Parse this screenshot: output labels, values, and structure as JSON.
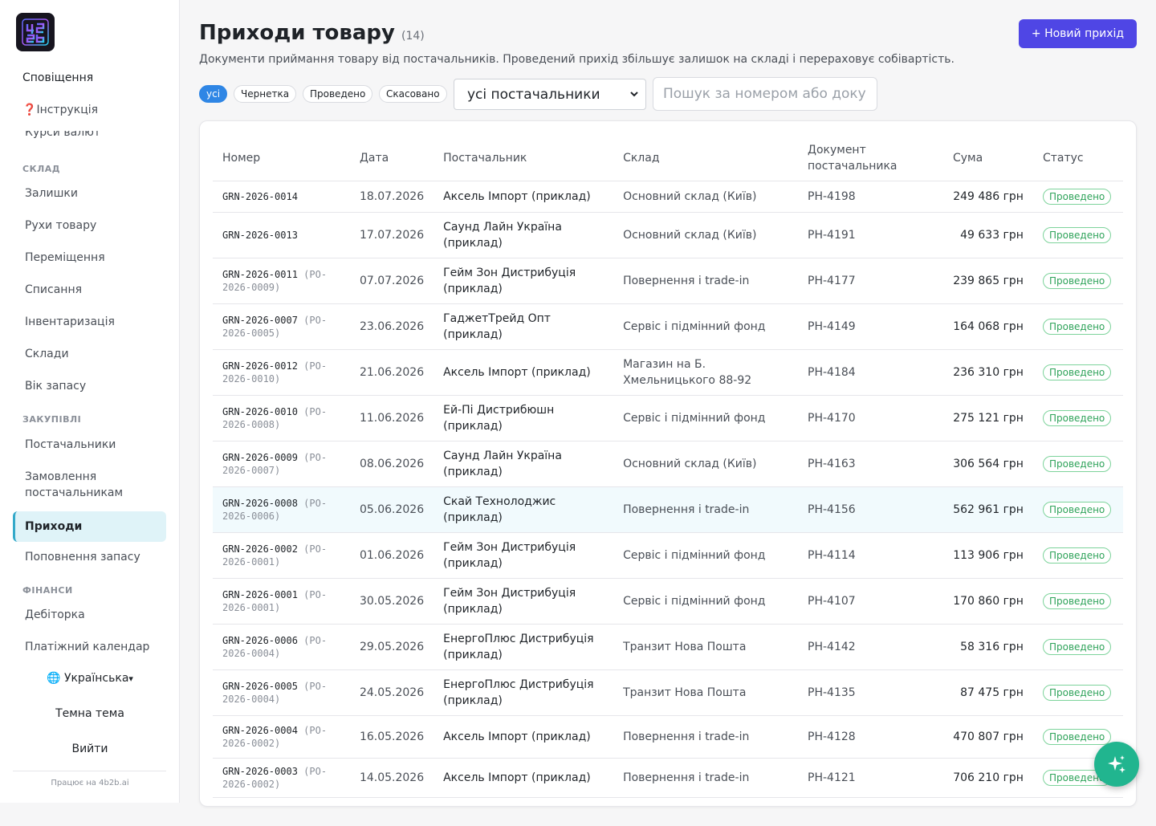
{
  "sidebar": {
    "notifications": "Сповіщення",
    "instructions_icon": "question-icon",
    "instructions": "Інструкція",
    "currency_cut": "Курси валют",
    "sections": {
      "warehouse": "СКЛАД",
      "purchases": "ЗАКУПІВЛІ",
      "finance": "ФІНАНСИ"
    },
    "warehouse_items": [
      "Залишки",
      "Рухи товару",
      "Переміщення",
      "Списання",
      "Інвентаризація",
      "Склади",
      "Вік запасу"
    ],
    "purchase_items": [
      "Постачальники",
      "Замовлення постачальникам",
      "Приходи",
      "Поповнення запасу"
    ],
    "finance_items": [
      "Дебіторка",
      "Платіжний календар"
    ],
    "language_icon": "globe-icon",
    "language": "Українська",
    "theme": "Темна тема",
    "logout": "Вийти",
    "powered": "Працює на 4b2b.ai"
  },
  "header": {
    "title": "Приходи товару",
    "count": "(14)",
    "subtitle": "Документи приймання товару від постачальників. Проведений прихід збільшує залишок на складі і перераховує собівартість.",
    "new_button": "+ Новий прихід"
  },
  "filters": {
    "chips": [
      "усі",
      "Чернетка",
      "Проведено",
      "Скасовано"
    ],
    "active_chip": "усі",
    "supplier_select": "усі постачальники",
    "search_placeholder": "Пошук за номером або документом",
    "search_value": ""
  },
  "table": {
    "headers": [
      "Номер",
      "Дата",
      "Постачальник",
      "Склад",
      "Документ постачальника",
      "Сума",
      "Статус"
    ],
    "rows": [
      {
        "num": "GRN-2026-0014",
        "po": "",
        "date": "18.07.2026",
        "supplier": "Аксель Імпорт (приклад)",
        "warehouse": "Основний склад (Київ)",
        "doc": "РН-4198",
        "sum": "249 486 грн",
        "status": "Проведено"
      },
      {
        "num": "GRN-2026-0013",
        "po": "",
        "date": "17.07.2026",
        "supplier": "Саунд Лайн Україна (приклад)",
        "warehouse": "Основний склад (Київ)",
        "doc": "РН-4191",
        "sum": "49 633 грн",
        "status": "Проведено"
      },
      {
        "num": "GRN-2026-0011",
        "po": "(PO-2026-0009)",
        "date": "07.07.2026",
        "supplier": "Гейм Зон Дистрибуція (приклад)",
        "warehouse": "Повернення і trade-in",
        "doc": "РН-4177",
        "sum": "239 865 грн",
        "status": "Проведено"
      },
      {
        "num": "GRN-2026-0007",
        "po": "(PO-2026-0005)",
        "date": "23.06.2026",
        "supplier": "ГаджетТрейд Опт (приклад)",
        "warehouse": "Сервіс і підмінний фонд",
        "doc": "РН-4149",
        "sum": "164 068 грн",
        "status": "Проведено"
      },
      {
        "num": "GRN-2026-0012",
        "po": "(PO-2026-0010)",
        "date": "21.06.2026",
        "supplier": "Аксель Імпорт (приклад)",
        "warehouse": "Магазин на Б. Хмельницького 88-92",
        "doc": "РН-4184",
        "sum": "236 310 грн",
        "status": "Проведено"
      },
      {
        "num": "GRN-2026-0010",
        "po": "(PO-2026-0008)",
        "date": "11.06.2026",
        "supplier": "Ей-Пі Дистрибюшн (приклад)",
        "warehouse": "Сервіс і підмінний фонд",
        "doc": "РН-4170",
        "sum": "275 121 грн",
        "status": "Проведено"
      },
      {
        "num": "GRN-2026-0009",
        "po": "(PO-2026-0007)",
        "date": "08.06.2026",
        "supplier": "Саунд Лайн Україна (приклад)",
        "warehouse": "Основний склад (Київ)",
        "doc": "РН-4163",
        "sum": "306 564 грн",
        "status": "Проведено"
      },
      {
        "num": "GRN-2026-0008",
        "po": "(PO-2026-0006)",
        "date": "05.06.2026",
        "supplier": "Скай Технолоджис (приклад)",
        "warehouse": "Повернення і trade-in",
        "doc": "РН-4156",
        "sum": "562 961 грн",
        "status": "Проведено"
      },
      {
        "num": "GRN-2026-0002",
        "po": "(PO-2026-0001)",
        "date": "01.06.2026",
        "supplier": "Гейм Зон Дистрибуція (приклад)",
        "warehouse": "Сервіс і підмінний фонд",
        "doc": "РН-4114",
        "sum": "113 906 грн",
        "status": "Проведено"
      },
      {
        "num": "GRN-2026-0001",
        "po": "(PO-2026-0001)",
        "date": "30.05.2026",
        "supplier": "Гейм Зон Дистрибуція (приклад)",
        "warehouse": "Сервіс і підмінний фонд",
        "doc": "РН-4107",
        "sum": "170 860 грн",
        "status": "Проведено"
      },
      {
        "num": "GRN-2026-0006",
        "po": "(PO-2026-0004)",
        "date": "29.05.2026",
        "supplier": "ЕнергоПлюс Дистрибуція (приклад)",
        "warehouse": "Транзит Нова Пошта",
        "doc": "РН-4142",
        "sum": "58 316 грн",
        "status": "Проведено"
      },
      {
        "num": "GRN-2026-0005",
        "po": "(PO-2026-0004)",
        "date": "24.05.2026",
        "supplier": "ЕнергоПлюс Дистрибуція (приклад)",
        "warehouse": "Транзит Нова Пошта",
        "doc": "РН-4135",
        "sum": "87 475 грн",
        "status": "Проведено"
      },
      {
        "num": "GRN-2026-0004",
        "po": "(PO-2026-0002)",
        "date": "16.05.2026",
        "supplier": "Аксель Імпорт (приклад)",
        "warehouse": "Повернення і trade-in",
        "doc": "РН-4128",
        "sum": "470 807 грн",
        "status": "Проведено"
      },
      {
        "num": "GRN-2026-0003",
        "po": "(PO-2026-0002)",
        "date": "14.05.2026",
        "supplier": "Аксель Імпорт (приклад)",
        "warehouse": "Повернення і trade-in",
        "doc": "РН-4121",
        "sum": "706 210 грн",
        "status": "Проведено"
      }
    ]
  },
  "fab_icon": "sparkle-icon",
  "colors": {
    "accent": "#4f46e5",
    "chip_active": "#2f86e5",
    "status_green": "#2fa35a",
    "active_nav_bg": "#dff3f8",
    "fab": "#21b58f"
  }
}
